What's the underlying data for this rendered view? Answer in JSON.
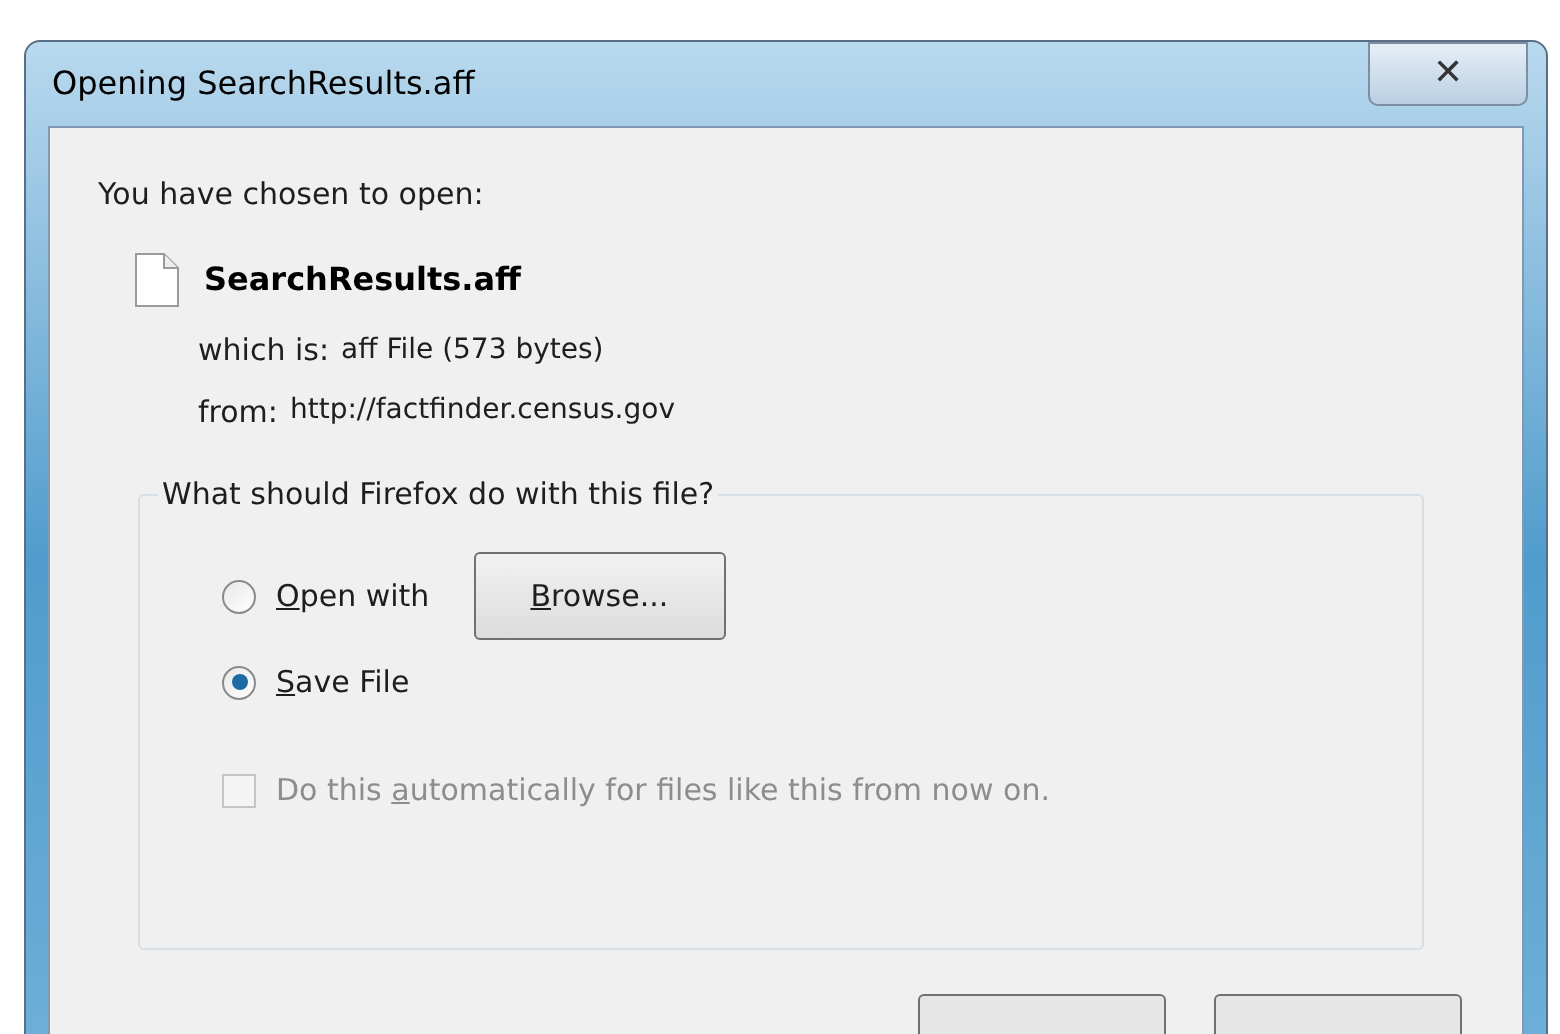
{
  "window": {
    "title": "Opening SearchResults.aff",
    "close": "✕"
  },
  "intro": "You have chosen to open:",
  "file": {
    "name": "SearchResults.aff",
    "details": [
      {
        "label": "which is:",
        "value": "aff File (573 bytes)"
      },
      {
        "label": "from:",
        "value": "http://factfinder.census.gov"
      }
    ]
  },
  "group": {
    "title": "What should Firefox do with this file?",
    "options": [
      {
        "kind": "radio",
        "key": "O",
        "after": "pen with",
        "selected": false,
        "button": {
          "key": "B",
          "after": "rowse..."
        }
      },
      {
        "kind": "radio",
        "key": "S",
        "after": "ave File",
        "selected": true
      },
      {
        "kind": "checkbox",
        "before": "Do this ",
        "key": "a",
        "after": "utomatically for files like this from now on.",
        "checked": false,
        "disabled": true
      }
    ]
  }
}
